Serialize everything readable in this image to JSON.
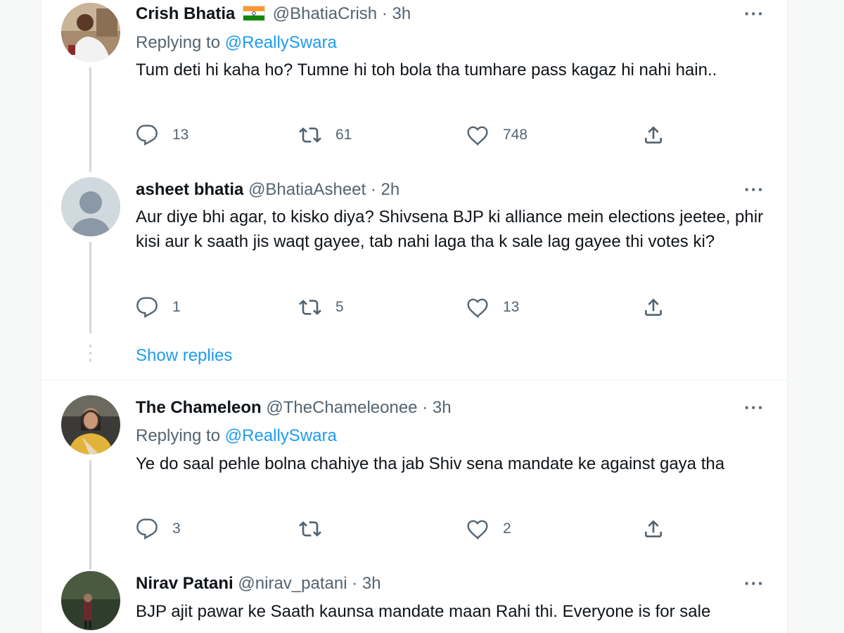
{
  "tweets": [
    {
      "name": "Crish Bhatia",
      "handle": "@BhatiaCrish",
      "time": "3h",
      "replying_label": "Replying to",
      "replying_to": "@ReallySwara",
      "text": "Tum deti hi kaha ho? Tumne hi toh bola tha tumhare pass kagaz hi nahi hain..",
      "replies": "13",
      "retweets": "61",
      "likes": "748"
    },
    {
      "name": "asheet bhatia",
      "handle": "@BhatiaAsheet",
      "time": "2h",
      "text": "Aur diye bhi agar, to kisko diya? Shivsena BJP ki alliance mein elections jeetee, phir kisi aur k saath jis waqt gayee, tab nahi laga tha k sale lag gayee thi votes ki?",
      "replies": "1",
      "retweets": "5",
      "likes": "13",
      "show_replies": "Show replies"
    },
    {
      "name": "The Chameleon",
      "handle": "@TheChameleonee",
      "time": "3h",
      "replying_label": "Replying to",
      "replying_to": "@ReallySwara",
      "text": "Ye do saal pehle bolna chahiye tha jab Shiv sena mandate ke against gaya tha",
      "replies": "3",
      "retweets": "",
      "likes": "2"
    },
    {
      "name": "Nirav Patani",
      "handle": "@nirav_patani",
      "time": "3h",
      "text": "BJP ajit pawar ke Saath kaunsa mandate maan Rahi thi. Everyone is for sale"
    }
  ],
  "separator": "·",
  "more_label": "···",
  "colors": {
    "accent": "#1d9bf0",
    "secondary_text": "#536471",
    "thread_line": "#cfd9de"
  },
  "icons": [
    "reply-icon",
    "retweet-icon",
    "like-icon",
    "share-icon",
    "more-icon",
    "india-flag-icon"
  ]
}
